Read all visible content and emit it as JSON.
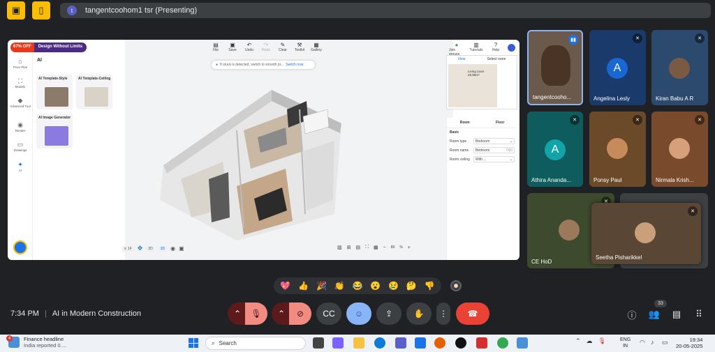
{
  "topbar": {
    "presenter_initial": "t",
    "presenting_title": "tangentcoohom1 tsr (Presenting)"
  },
  "share": {
    "promo": {
      "discount": "67% OFF",
      "tagline": "Design Without Limits"
    },
    "toolbar": [
      "File",
      "Save",
      "Undo",
      "Redo",
      "Clear",
      "Toolkit",
      "Gallery"
    ],
    "right_tools": [
      "Join groups",
      "Tutorials",
      "Help"
    ],
    "notice": {
      "text": "If stuck is detected, switch to smooth pr...",
      "link": "Switch now"
    },
    "left_rail": [
      "Floor Plan",
      "Models",
      "Advanced Tool",
      "Render",
      "Drawings",
      "AI"
    ],
    "ai_panel": {
      "title": "AI",
      "cards": [
        "AI Template-Style",
        "AI Template-Ceiling",
        "AI Image Generator"
      ]
    },
    "minimap": {
      "tabs": [
        "View",
        "Select room"
      ],
      "room_label": "Living room",
      "room_area": "26.86m²"
    },
    "props": {
      "tabs": [
        "Room",
        "Floor"
      ],
      "section": "Basic",
      "rows": [
        {
          "label": "Room type",
          "value": "Bedroom",
          "extra": ""
        },
        {
          "label": "Room name",
          "value": "Bedroom",
          "extra": "7/60"
        },
        {
          "label": "Room ceiling",
          "value": "With ...",
          "extra": ""
        }
      ]
    },
    "bottom_tools": {
      "floor": "1F",
      "view2d": "2D",
      "view3d": "3D"
    },
    "zoom": "89",
    "zoom_unit": "%"
  },
  "participants": [
    {
      "name": "tangentcooho...",
      "initial": ""
    },
    {
      "name": "Angelina Lesly",
      "initial": "A"
    },
    {
      "name": "Kiran Babu A R",
      "initial": ""
    },
    {
      "name": "Athira Ananda...",
      "initial": "A"
    },
    {
      "name": "Ponsy Paul",
      "initial": ""
    },
    {
      "name": "Nirmala Krish...",
      "initial": ""
    },
    {
      "name": "CE HoD",
      "initial": ""
    },
    {
      "name": "Seetha Pisharikkel",
      "initial": ""
    }
  ],
  "reactions": [
    "💖",
    "👍",
    "🎉",
    "👏",
    "😂",
    "😮",
    "😢",
    "🤔",
    "👎"
  ],
  "meeting": {
    "time": "7:34 PM",
    "separator": "|",
    "name": "AI in Modern Construction"
  },
  "people_count": "33",
  "taskbar": {
    "news_badge": "4",
    "news_title": "Finance headline",
    "news_sub": "India reported 0....",
    "search_placeholder": "Search",
    "lang_line1": "ENG",
    "lang_line2": "IN",
    "time": "19:34",
    "date": "20-05-2025"
  },
  "colors": {
    "accent": "#8ab4f8",
    "hangup": "#ea4335",
    "mic_off": "#f28b82",
    "warning": "#fbbc04"
  }
}
